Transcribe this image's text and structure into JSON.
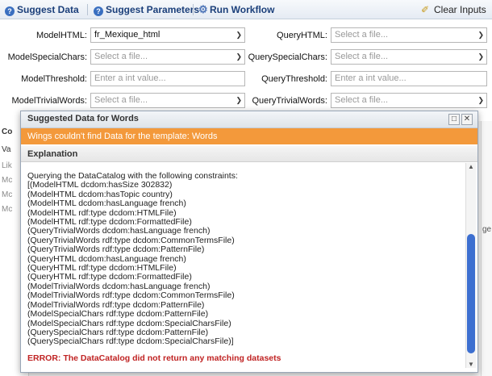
{
  "toolbar": {
    "suggest_data": "Suggest Data",
    "suggest_params": "Suggest Parameters",
    "run_workflow": "Run Workflow",
    "clear_inputs": "Clear Inputs"
  },
  "form": {
    "left": [
      {
        "label": "ModelHTML:",
        "value": "fr_Mexique_html",
        "placeholder": ""
      },
      {
        "label": "ModelSpecialChars:",
        "value": "",
        "placeholder": "Select a file..."
      },
      {
        "label": "ModelThreshold:",
        "value": "",
        "placeholder": "Enter a int value..."
      },
      {
        "label": "ModelTrivialWords:",
        "value": "",
        "placeholder": "Select a file..."
      }
    ],
    "right": [
      {
        "label": "QueryHTML:",
        "value": "",
        "placeholder": "Select a file..."
      },
      {
        "label": "QuerySpecialChars:",
        "value": "",
        "placeholder": "Select a file..."
      },
      {
        "label": "QueryThreshold:",
        "value": "",
        "placeholder": "Enter a int value..."
      },
      {
        "label": "QueryTrivialWords:",
        "value": "",
        "placeholder": "Select a file..."
      }
    ]
  },
  "background": {
    "panel_title": "Co",
    "col": "Va",
    "rows": [
      "Lik",
      "Mc",
      "Mc",
      "Mc"
    ],
    "side_text": "ge"
  },
  "dialog": {
    "title": "Suggested Data for Words",
    "warning": "Wings couldn't find Data for the template: Words",
    "explanation_header": "Explanation",
    "lines": [
      "Querying the DataCatalog with the following constraints:",
      "[(ModelHTML dcdom:hasSize 302832)",
      "(ModelHTML dcdom:hasTopic country)",
      "(ModelHTML dcdom:hasLanguage french)",
      "(ModelHTML rdf:type dcdom:HTMLFile)",
      "(ModelHTML rdf:type dcdom:FormattedFile)",
      "(QueryTrivialWords dcdom:hasLanguage french)",
      "(QueryTrivialWords rdf:type dcdom:CommonTermsFile)",
      "(QueryTrivialWords rdf:type dcdom:PatternFile)",
      "(QueryHTML dcdom:hasLanguage french)",
      "(QueryHTML rdf:type dcdom:HTMLFile)",
      "(QueryHTML rdf:type dcdom:FormattedFile)",
      "(ModelTrivialWords dcdom:hasLanguage french)",
      "(ModelTrivialWords rdf:type dcdom:CommonTermsFile)",
      "(ModelTrivialWords rdf:type dcdom:PatternFile)",
      "(ModelSpecialChars rdf:type dcdom:PatternFile)",
      "(ModelSpecialChars rdf:type dcdom:SpecialCharsFile)",
      "(QuerySpecialChars rdf:type dcdom:PatternFile)",
      "(QuerySpecialChars rdf:type dcdom:SpecialCharsFile)]"
    ],
    "error": "ERROR: The DataCatalog did not return any matching datasets"
  }
}
